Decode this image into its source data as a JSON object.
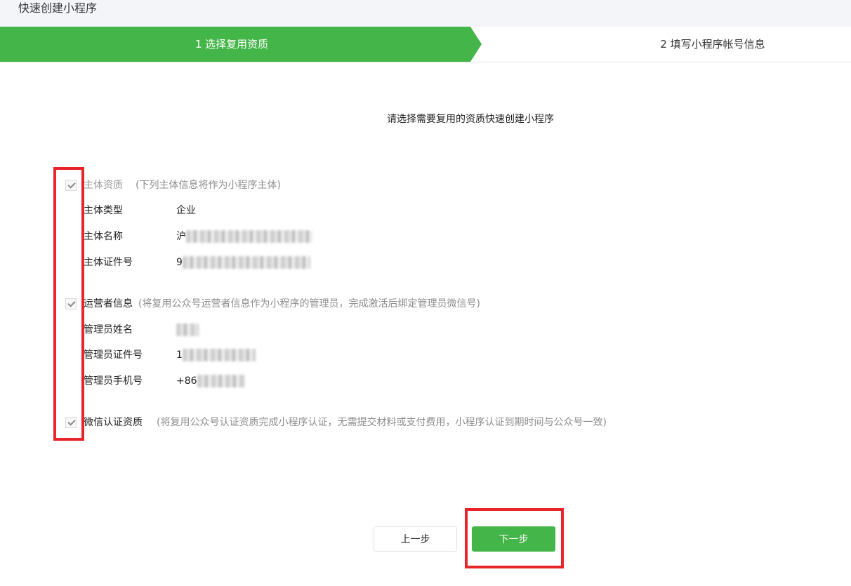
{
  "page": {
    "title": "快速创建小程序"
  },
  "steps": [
    {
      "label": "1 选择复用资质"
    },
    {
      "label": "2 填写小程序帐号信息"
    }
  ],
  "heading": "请选择需要复用的资质快速创建小程序",
  "sections": {
    "entity": {
      "name": "主体资质",
      "note": "(下列主体信息将作为小程序主体)",
      "rows": [
        {
          "label": "主体类型",
          "value": "企业"
        },
        {
          "label": "主体名称",
          "value": "沪"
        },
        {
          "label": "主体证件号",
          "value": "9"
        }
      ]
    },
    "operator": {
      "name": "运营者信息",
      "note": "(将复用公众号运营者信息作为小程序的管理员，完成激活后绑定管理员微信号)",
      "rows": [
        {
          "label": "管理员姓名",
          "value": ""
        },
        {
          "label": "管理员证件号",
          "value": "1"
        },
        {
          "label": "管理员手机号",
          "value": "+86"
        }
      ]
    },
    "certification": {
      "name": "微信认证资质",
      "note": "(将复用公众号认证资质完成小程序认证，无需提交材料或支付费用，小程序认证到期时间与公众号一致)"
    }
  },
  "buttons": {
    "prev": "上一步",
    "next": "下一步"
  },
  "colors": {
    "accent": "#44b549",
    "highlight": "#e8242a"
  }
}
